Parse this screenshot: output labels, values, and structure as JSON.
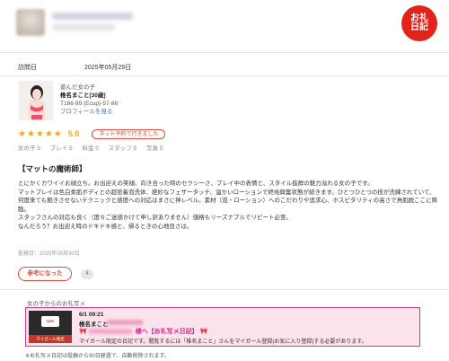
{
  "header": {
    "logo_line1": "お礼",
    "logo_line2": "日記"
  },
  "visit": {
    "label": "訪問日",
    "date": "2025年05月29日"
  },
  "girl": {
    "played_label": "遊んだ女の子",
    "name": "椎名まこと[30歳]",
    "measurements": "T166·89 (Ecup)·57·88",
    "profile_link": "プロフィールを見る"
  },
  "rating": {
    "stars": "★★★★★",
    "score": "5.0",
    "badge": "ネット予約で行きました"
  },
  "subscores": {
    "girl": "女の子 5",
    "play": "プレイ 5",
    "price": "料金 5",
    "staff": "スタッフ 5",
    "photo": "写真 5"
  },
  "review": {
    "title": "【マットの魔術師】",
    "body": "とにかくカワイイお顔立ち。お出迎えの笑顔、向き合った時のセクシーさ、プレイ中の表情と、スタイル抜群の魅力溢れる女の子です。\nマットプレイは色白柔肌ボディとの超密着泡洗体、絶妙なフェザータッチ、温かいローションで終始興奮状態が続きます。ひとつひとつの技が洗練されていて、何度来ても飽きさせないテクニックと感度への対応はまさに神レベル。素材（泡・ローション）へのこだわりや追求心、ホスピタリティの高さで鳥肌脱ここに降臨。\nスタッフさんの対応も良く（度々ご迷惑かけて申し訳ありません）価格もリーズナブルでリピート必至。\nなんだろう？お出迎え時のドキドキ感と、帰るときの心地良さは。",
    "posted_date": "投稿日：2025年05月30日"
  },
  "helpful": {
    "label": "参考になった",
    "count": "4"
  },
  "thanks": {
    "section_title": "女の子からのお礼写メ",
    "datetime": "6/1 09:21",
    "girl_name": "椎名まこと",
    "headline_suffix": "様へ【お礼写メ日記】",
    "note": "マイガール限定の日記です。閲覧するには「椎名まこと」さんをマイガール登録(お気に入り登録)する必要があります。",
    "thumb_label": "マイガール限定",
    "thumb_tap": "TAP!"
  },
  "footer": {
    "note": "※お礼写メ日記は投稿から90日経過で、自動削除されます。"
  },
  "colors": {
    "accent": "#e04b3c",
    "star": "#f0a81d",
    "pink_box": "#fde3ee",
    "pink_border": "#d23a85",
    "link": "#3a6fc4"
  }
}
